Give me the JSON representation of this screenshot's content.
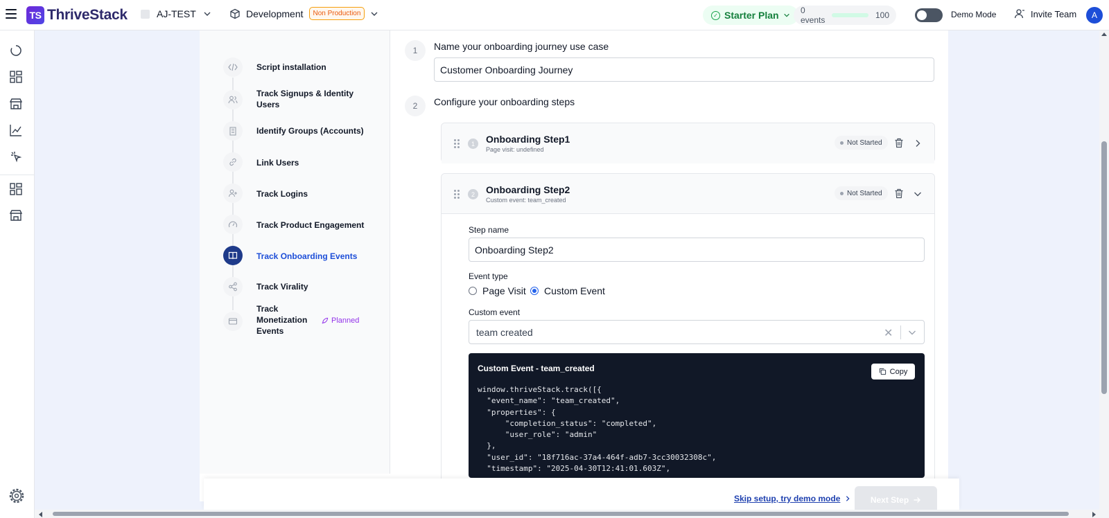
{
  "app": {
    "logo_mark": "TS",
    "logo_text": "ThriveStack"
  },
  "header": {
    "org_name": "AJ-TEST",
    "environment": "Development",
    "environment_badge": "Non Production",
    "plan": "Starter Plan",
    "events_label": "0 events",
    "events_limit": "100",
    "events_used_fraction": 0.0,
    "demo_mode_label": "Demo Mode",
    "invite_label": "Invite Team",
    "avatar_initial": "A"
  },
  "stepnav": {
    "items": [
      {
        "label": "Script installation",
        "icon": "code-icon"
      },
      {
        "label": "Track Signups & Identity Users",
        "icon": "users-icon"
      },
      {
        "label": "Identify Groups (Accounts)",
        "icon": "building-icon"
      },
      {
        "label": "Link Users",
        "icon": "link-icon"
      },
      {
        "label": "Track Logins",
        "icon": "user-plus-icon"
      },
      {
        "label": "Track Product Engagement",
        "icon": "gauge-icon"
      },
      {
        "label": "Track Onboarding Events",
        "icon": "book-icon",
        "active": true
      },
      {
        "label": "Track Virality",
        "icon": "share-icon"
      },
      {
        "label": "Track Monetization Events",
        "icon": "card-icon"
      }
    ],
    "planned_label": "Planned"
  },
  "main": {
    "section1": {
      "number": "1",
      "title": "Name your onboarding journey use case",
      "value": "Customer Onboarding Journey"
    },
    "section2": {
      "number": "2",
      "title": "Configure your onboarding steps"
    },
    "steps": [
      {
        "number": "1",
        "title": "Onboarding Step1",
        "subtitle": "Page visit: undefined",
        "status": "Not Started"
      },
      {
        "number": "2",
        "title": "Onboarding Step2",
        "subtitle": "Custom event: team_created",
        "status": "Not Started"
      }
    ],
    "expanded": {
      "step_name_label": "Step name",
      "step_name_value": "Onboarding Step2",
      "event_type_label": "Event type",
      "option_page_visit": "Page Visit",
      "option_custom_event": "Custom Event",
      "custom_event_label": "Custom event",
      "custom_event_value": "team created",
      "code_title": "Custom Event - team_created",
      "copy_label": "Copy",
      "code": "window.thriveStack.track([{\n  \"event_name\": \"team_created\",\n  \"properties\": {\n      \"completion_status\": \"completed\",\n      \"user_role\": \"admin\"\n  },\n  \"user_id\": \"18f716ac-37a4-464f-adb7-3cc30032308c\",\n  \"timestamp\": \"2025-04-30T12:41:01.603Z\","
    }
  },
  "footer": {
    "skip_label": "Skip setup, try demo mode",
    "next_label": "Next Step"
  },
  "colors": {
    "brand": "#4f46e5",
    "active_step": "#1e3a8a",
    "plan_green": "#15803d",
    "workspace_bg": "#eef2fc"
  }
}
